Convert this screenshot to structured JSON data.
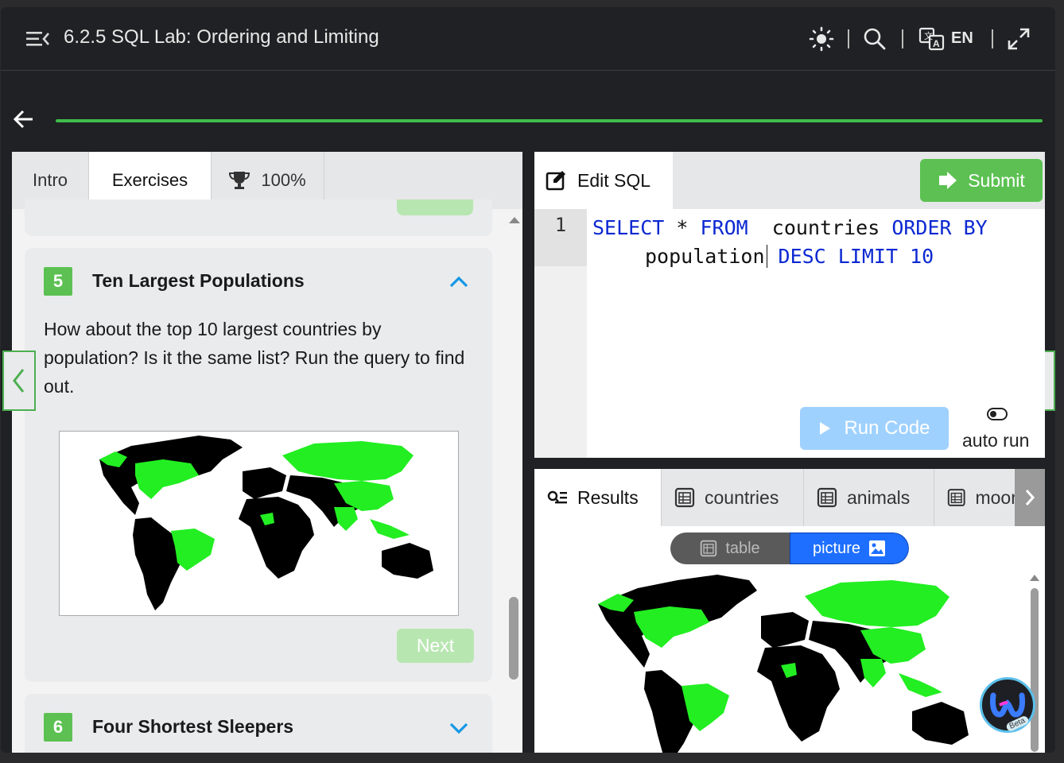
{
  "app": {
    "title": "6.2.5 SQL Lab: Ordering and Limiting",
    "language": "EN",
    "accent_color": "#3ebd4a",
    "menu_icon": "collapse-menu-icon",
    "icons": [
      "brightness-icon",
      "search-icon",
      "translate-icon",
      "fullscreen-icon"
    ]
  },
  "left_panel": {
    "tabs": [
      {
        "label": "Intro"
      },
      {
        "label": "Exercises"
      },
      {
        "label": "100%",
        "icon": "trophy-icon"
      }
    ],
    "exercise5": {
      "number": "5",
      "title": "Ten Largest Populations",
      "description": "How about the top 10 largest countries by population? Is it the same list? Run the query to find out.",
      "next_label": "Next"
    },
    "exercise6": {
      "number": "6",
      "title": "Four Shortest Sleepers"
    }
  },
  "editor": {
    "tab_label": "Edit SQL",
    "submit_label": "Submit",
    "line_number": "1",
    "code": {
      "t1": "SELECT",
      "t2": " * ",
      "t3": "FROM",
      "t4": "  countries ",
      "t5": "ORDER BY",
      "t6": "population",
      "t7": "DESC LIMIT 10"
    },
    "run_label": "Run Code",
    "auto_run_label": "auto run",
    "auto_run_enabled": false
  },
  "results": {
    "tabs": [
      {
        "label": "Results",
        "icon": "results-icon"
      },
      {
        "label": "countries",
        "icon": "table-icon"
      },
      {
        "label": "animals",
        "icon": "table-icon"
      },
      {
        "label": "moon",
        "icon": "table-icon"
      }
    ],
    "view_toggle": {
      "table": "table",
      "picture": "picture",
      "selected": "picture"
    }
  },
  "helper": {
    "badge": "Beta"
  }
}
